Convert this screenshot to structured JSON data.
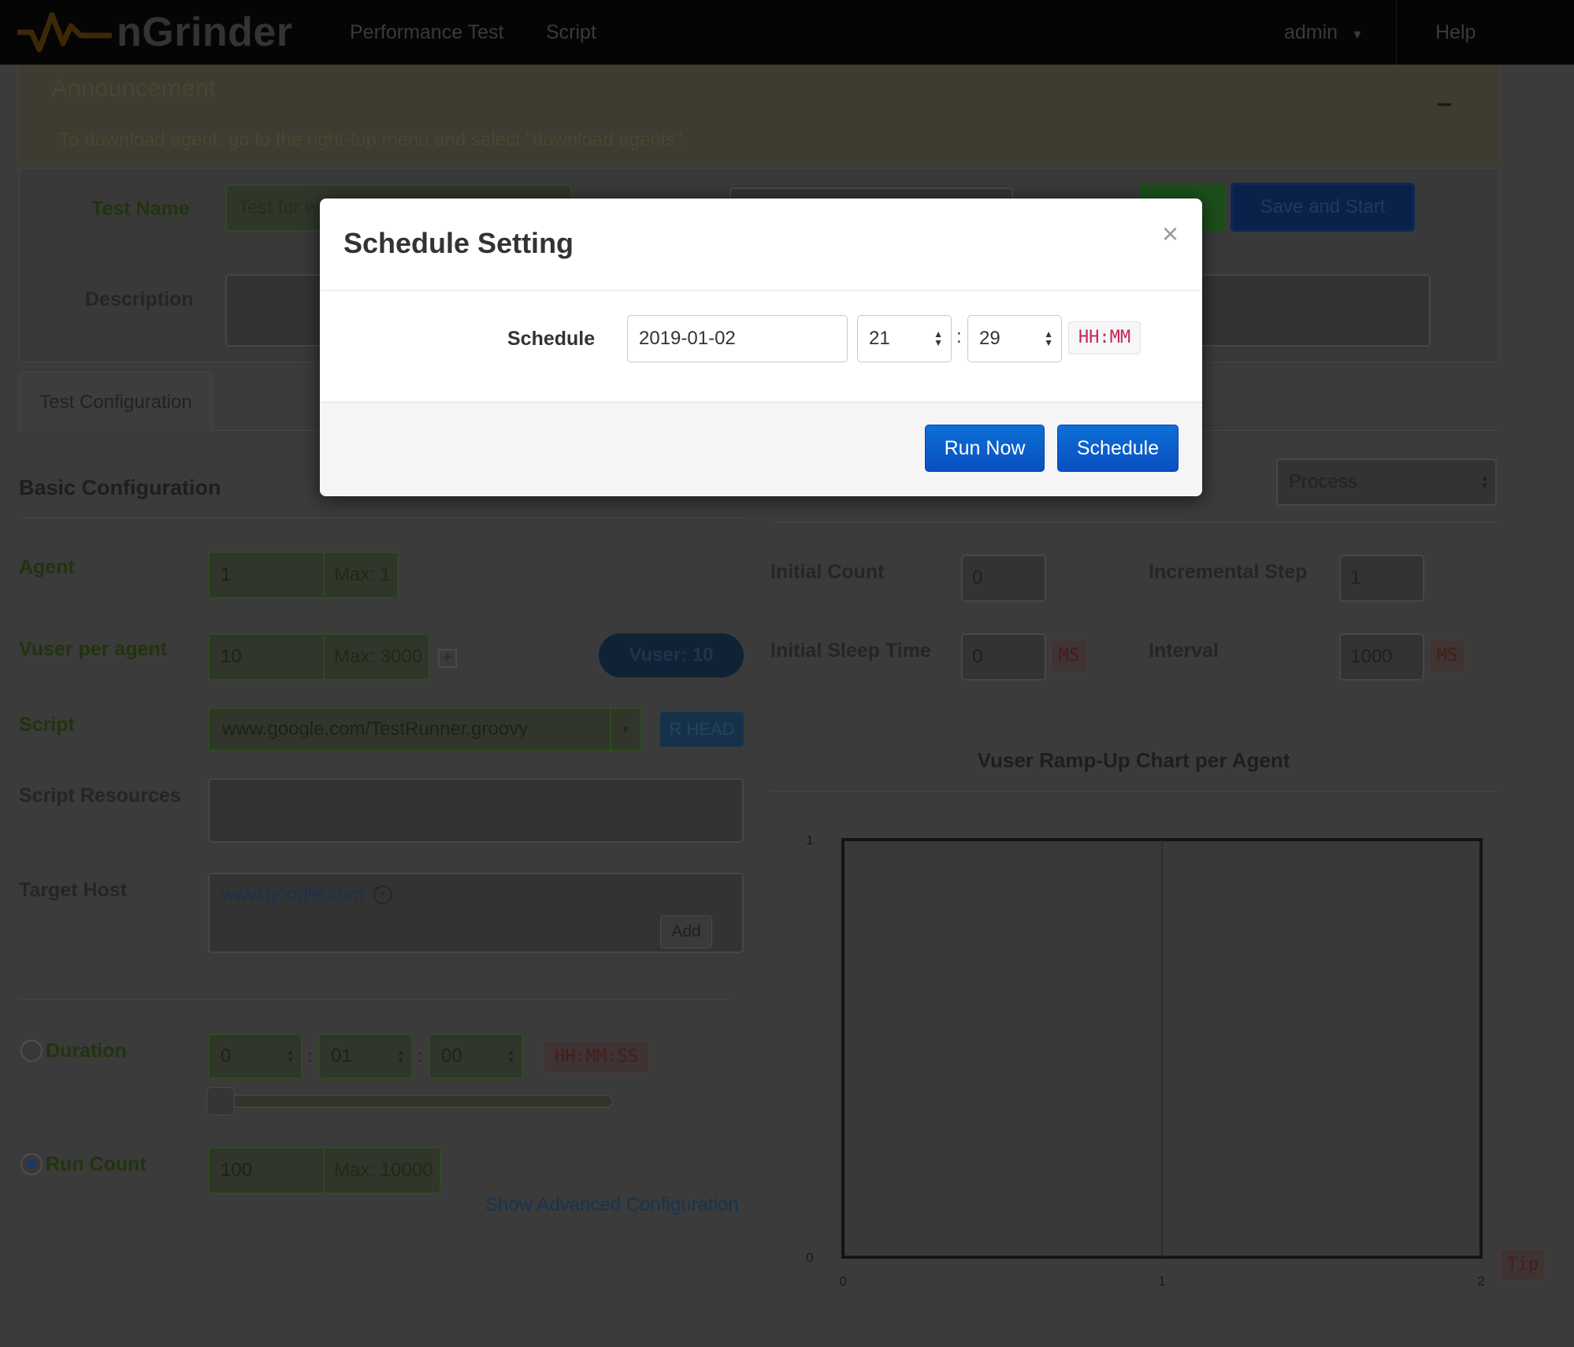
{
  "navbar": {
    "brand": "nGrinder",
    "links": [
      "Performance Test",
      "Script"
    ],
    "user": "admin",
    "help": "Help"
  },
  "announcement": {
    "title": "Announcement",
    "toggle": "–",
    "message": "To download agent, go to the right-top menu and select \"download agents\"."
  },
  "test_form": {
    "test_name_label": "Test Name",
    "test_name_value": "Test for w",
    "description_label": "Description",
    "save_start_label": "Save and Start"
  },
  "tabs": {
    "test_configuration": "Test Configuration"
  },
  "basic_config": {
    "title": "Basic Configuration",
    "agent_label": "Agent",
    "agent_value": "1",
    "agent_max": "Max: 1",
    "vuser_label": "Vuser per agent",
    "vuser_value": "10",
    "vuser_max": "Max: 3000",
    "vuser_badge": "Vuser: 10",
    "script_label": "Script",
    "script_value": "www.google.com/TestRunner.groovy",
    "script_rev": "R HEAD",
    "resources_label": "Script Resources",
    "target_host_label": "Target Host",
    "target_host_value": "www.google.com",
    "add_label": "Add",
    "duration_label": "Duration",
    "duration_hh": "0",
    "duration_mm": "01",
    "duration_ss": "00",
    "duration_format": "HH:MM:SS",
    "duration_slider_fraction": 0,
    "run_count_label": "Run Count",
    "run_count_value": "100",
    "run_count_max": "Max: 10000",
    "advanced_link": "Show Advanced Configuration"
  },
  "rampup": {
    "process_select": "Process",
    "initial_count_label": "Initial Count",
    "initial_count_value": "0",
    "incremental_step_label": "Incremental Step",
    "incremental_step_value": "1",
    "initial_sleep_label": "Initial Sleep Time",
    "initial_sleep_value": "0",
    "ms_unit": "MS",
    "interval_label": "Interval",
    "interval_value": "1000",
    "tip": "Tip"
  },
  "chart_data": {
    "type": "line",
    "title": "Vuser Ramp-Up Chart per Agent",
    "x_ticks": [
      "0",
      "1",
      "2"
    ],
    "y_ticks": [
      "0",
      "1"
    ],
    "xlim": [
      0,
      2
    ],
    "ylim": [
      0,
      1
    ],
    "series": []
  },
  "modal": {
    "title": "Schedule Setting",
    "close": "×",
    "schedule_label": "Schedule",
    "date_value": "2019-01-02",
    "hour_value": "21",
    "minute_value": "29",
    "separator": ":",
    "format_tag": "HH:MM",
    "run_now_label": "Run Now",
    "schedule_button_label": "Schedule"
  },
  "colors": {
    "modal_button": "#0a56c8",
    "navbar": "#050505",
    "format_tag_text": "#c7254e"
  }
}
